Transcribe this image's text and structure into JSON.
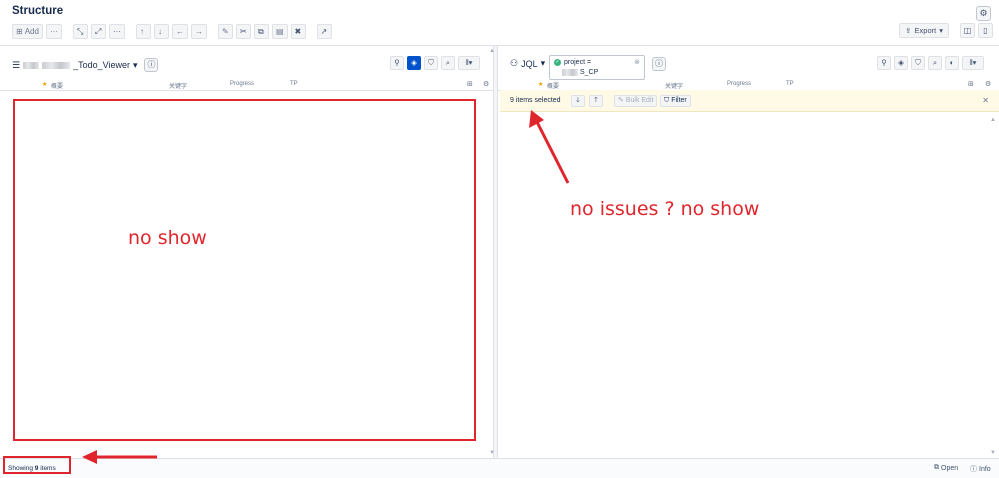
{
  "header": {
    "title": "Structure",
    "add_label": "Add",
    "export_label": "Export"
  },
  "toolbar": {
    "icons": [
      "more-icon",
      "expand-icon",
      "collapse-icon",
      "more-icon",
      "move-up-icon",
      "move-down-icon",
      "move-left-icon",
      "move-right-icon",
      "edit-icon",
      "cut-icon",
      "copy-icon",
      "paste-icon",
      "delete-icon",
      "automation-icon"
    ]
  },
  "left_panel": {
    "view_name": "_Todo_Viewer",
    "columns": [
      "概要",
      "关键字",
      "Progress",
      "TP"
    ]
  },
  "right_panel": {
    "jql_label": "JQL",
    "jql_line1": "project =",
    "jql_line2": "S_CP",
    "columns": [
      "概要",
      "关键字",
      "Progress",
      "TP"
    ],
    "selection_text": "9 items selected",
    "bulk_edit_label": "Bulk Edit",
    "filter_label": "Filter"
  },
  "footer": {
    "showing_prefix": "Showing",
    "showing_count": "9",
    "showing_suffix": "items",
    "open_label": "Open",
    "info_label": "Info"
  },
  "annotations": {
    "left_note": "no show",
    "right_note": "no issues ?   no show",
    "color": "#e0262d"
  },
  "colors": {
    "accent": "#0052cc",
    "selection_bg": "#fffae6",
    "success": "#36b37e"
  }
}
